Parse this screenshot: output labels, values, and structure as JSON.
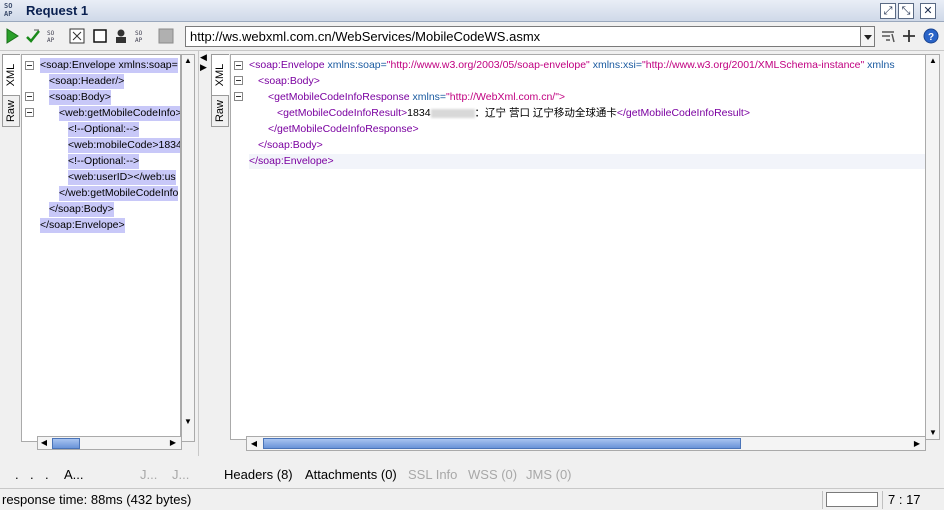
{
  "window": {
    "title": "Request 1",
    "logo_text": "SO AP"
  },
  "toolbar": {
    "url": "http://ws.webxml.com.cn/WebServices/MobileCodeWS.asmx",
    "icons": [
      "run-icon",
      "validate-icon",
      "format-icon",
      "window-icon",
      "user-icon",
      "settings-icon",
      "stop-icon",
      "add-icon",
      "help-icon"
    ]
  },
  "left_tabs": {
    "xml": "XML",
    "raw": "Raw"
  },
  "right_tabs": {
    "xml": "XML",
    "raw": "Raw"
  },
  "request_lines": [
    "<soap:Envelope xmlns:soap=",
    "<soap:Header/>",
    "<soap:Body>",
    "<web:getMobileCodeInfo>",
    "<!--Optional:-->",
    "<web:mobileCode>1834",
    "<!--Optional:-->",
    "<web:userID></web:us",
    "</web:getMobileCodeInfo",
    "</soap:Body>",
    "</soap:Envelope>"
  ],
  "response": {
    "envelope_open_tag": "<soap:Envelope",
    "envelope_attr1_name": "xmlns:soap=",
    "envelope_attr1_value": "\"http://www.w3.org/2003/05/soap-envelope\"",
    "envelope_attr2_name": "xmlns:xsi=",
    "envelope_attr2_value": "\"http://www.w3.org/2001/XMLSchema-instance\"",
    "envelope_attr3_name": "xmlns",
    "body_open": "<soap:Body>",
    "response_open_tag": "<getMobileCodeInfoResponse",
    "response_attr_name": "xmlns=",
    "response_attr_value": "\"http://WebXml.com.cn/\">",
    "result_open": "<getMobileCodeInfoResult>",
    "result_text_prefix": "1834",
    "result_text_suffix": "：辽宁 营口 辽宁移动全球通卡",
    "result_close": "</getMobileCodeInfoResult>",
    "response_close": "</getMobileCodeInfoResponse>",
    "body_close": "</soap:Body>",
    "envelope_close": "</soap:Envelope>"
  },
  "bottom_tabs_left": [
    ".",
    ".",
    ".",
    "A...",
    "J...",
    "J..."
  ],
  "bottom_tabs_right": [
    {
      "label": "Headers (8)",
      "enabled": true
    },
    {
      "label": "Attachments (0)",
      "enabled": true
    },
    {
      "label": "SSL Info",
      "enabled": false
    },
    {
      "label": "WSS (0)",
      "enabled": false
    },
    {
      "label": "JMS (0)",
      "enabled": false
    }
  ],
  "status": {
    "response_time": "response time: 88ms (432 bytes)",
    "caret": "7 : 17"
  },
  "colors": {
    "tag": "#7a00a0",
    "attr": "#1a5aa0",
    "value": "#c00080",
    "selection": "#c8c8f8"
  }
}
